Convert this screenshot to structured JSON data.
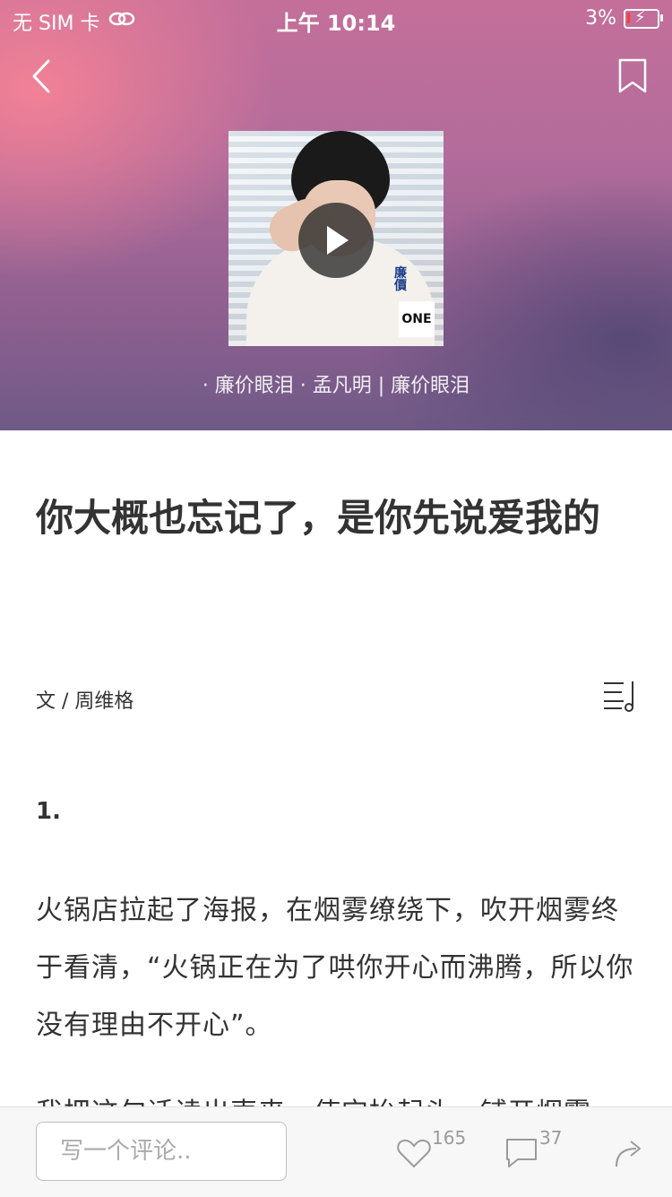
{
  "status_bar": {
    "carrier": "无 SIM 卡",
    "time": "上午 10:14",
    "battery": "3%"
  },
  "icons": {
    "back": "back-icon",
    "bookmark": "bookmark-icon",
    "play": "play-icon",
    "playlist": "playlist-icon",
    "like": "heart-icon",
    "comment": "comment-icon",
    "share": "share-icon",
    "link": "link-icon"
  },
  "music": {
    "song_line": "· 廉价眼泪 · 孟凡明 | 廉价眼泪",
    "cover_badge": "ONE",
    "cover_text": "廉價"
  },
  "article": {
    "title": "你大概也忘记了，是你先说爱我的",
    "author": "文 / 周维格",
    "section": "1.",
    "paragraph": "火锅店拉起了海报，在烟雾缭绕下，吹开烟雾终于看清，“火锅正在为了哄你开心而沸腾，所以你没有理由不开心”。",
    "next_paragraph_partial": "我把这句话读出声来，使它抬起头，铺开烟雾"
  },
  "bottom_bar": {
    "comment_placeholder": "写一个评论..",
    "like_count": "165",
    "comment_count": "37"
  },
  "colors": {
    "battery_low": "#ff3b30",
    "text": "#333333",
    "muted": "#9a9a9a"
  }
}
